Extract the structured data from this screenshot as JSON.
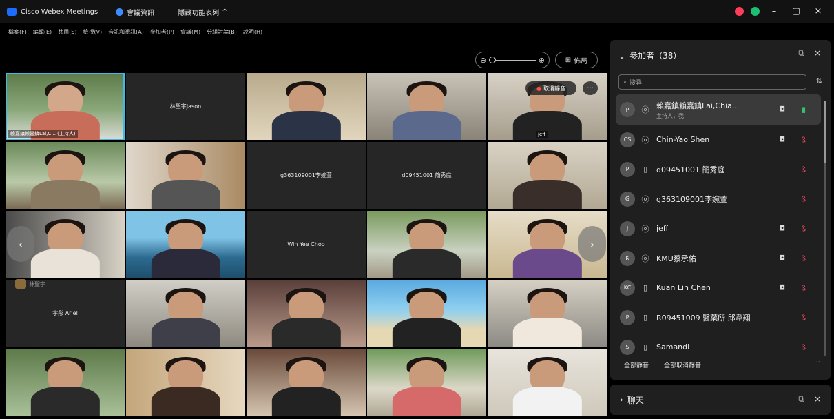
{
  "titlebar": {
    "app_title": "Cisco Webex Meetings",
    "meeting_info": "會議資訊",
    "hidden_menu": "隱藏功能表列",
    "chevron": "^",
    "minimize": "–",
    "restore": "▢",
    "close": "×"
  },
  "menu": [
    "檔案(F)",
    "編輯(E)",
    "共用(S)",
    "檢視(V)",
    "音訊和視訊(A)",
    "參加者(P)",
    "會議(M)",
    "分組討論(B)",
    "說明(H)"
  ],
  "controls": {
    "zoom_out": "⊖",
    "zoom_in": "⊕",
    "layout_label": "佈局",
    "layout_icon": "⊞"
  },
  "video": {
    "active_label": "賴嘉鎮賴嘉鎮Lai,C... (主持人)",
    "tile_names": {
      "jason": "林聖宇Jason",
      "g363": "g363109001李婉萱",
      "d094": "d09451001 簡秀庭",
      "win": "Win Yee Choo",
      "ariel": "宇彤 Ariel",
      "jeff": "jeff"
    },
    "unmute": "取消靜音",
    "more": "···",
    "thumb_tag": "林聖宇",
    "prev": "‹",
    "next": "›"
  },
  "panel": {
    "title": "參加者（38）",
    "search_placeholder": "搜尋",
    "participants": [
      {
        "initials": "P",
        "name": "賴嘉鎮賴嘉鎮Lai,Chia...",
        "sub": "主持人，我",
        "dev": "headset",
        "cam": true,
        "mic": "on"
      },
      {
        "initials": "CS",
        "name": "Chin-Yao Shen",
        "sub": "",
        "dev": "headset",
        "cam": true,
        "mic": "off"
      },
      {
        "initials": "P",
        "name": "d09451001 簡秀庭",
        "sub": "",
        "dev": "phone",
        "cam": false,
        "mic": "off"
      },
      {
        "initials": "G",
        "name": "g363109001李婉萱",
        "sub": "",
        "dev": "headset",
        "cam": false,
        "mic": "off"
      },
      {
        "initials": "J",
        "name": "jeff",
        "sub": "",
        "dev": "headset",
        "cam": true,
        "mic": "off"
      },
      {
        "initials": "K",
        "name": "KMU蔡承佑",
        "sub": "",
        "dev": "headset",
        "cam": true,
        "mic": "off"
      },
      {
        "initials": "KC",
        "name": "Kuan Lin Chen",
        "sub": "",
        "dev": "phone",
        "cam": true,
        "mic": "off"
      },
      {
        "initials": "P",
        "name": "R09451009 醫藥所 邱韋翔",
        "sub": "",
        "dev": "phone",
        "cam": false,
        "mic": "off"
      },
      {
        "initials": "S",
        "name": "Samandi",
        "sub": "",
        "dev": "phone",
        "cam": false,
        "mic": "off"
      }
    ],
    "mute_all": "全部靜音",
    "unmute_all": "全部取消靜音",
    "more": "···"
  },
  "chat": {
    "label": "聊天"
  }
}
